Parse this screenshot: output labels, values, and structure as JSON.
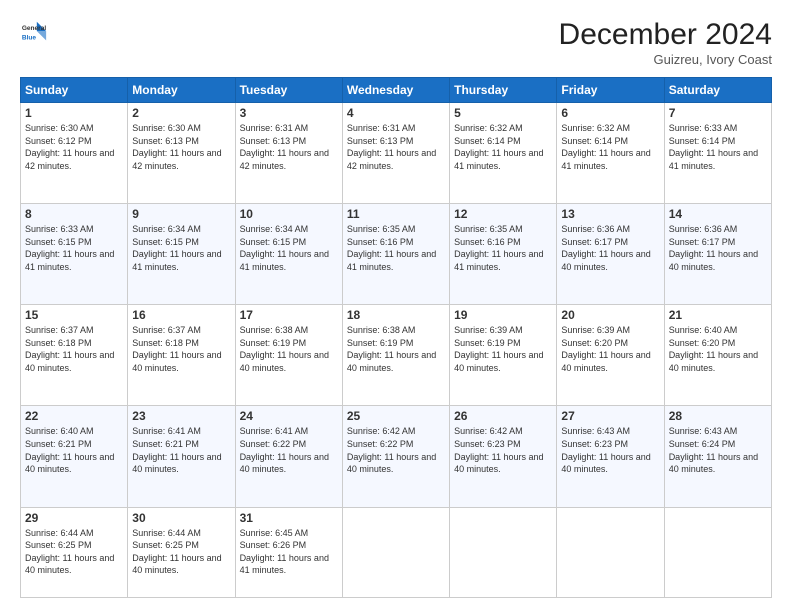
{
  "header": {
    "logo_line1": "General",
    "logo_line2": "Blue",
    "month": "December 2024",
    "location": "Guizreu, Ivory Coast"
  },
  "weekdays": [
    "Sunday",
    "Monday",
    "Tuesday",
    "Wednesday",
    "Thursday",
    "Friday",
    "Saturday"
  ],
  "weeks": [
    [
      {
        "day": "1",
        "sunrise": "6:30 AM",
        "sunset": "6:12 PM",
        "daylight": "11 hours and 42 minutes."
      },
      {
        "day": "2",
        "sunrise": "6:30 AM",
        "sunset": "6:13 PM",
        "daylight": "11 hours and 42 minutes."
      },
      {
        "day": "3",
        "sunrise": "6:31 AM",
        "sunset": "6:13 PM",
        "daylight": "11 hours and 42 minutes."
      },
      {
        "day": "4",
        "sunrise": "6:31 AM",
        "sunset": "6:13 PM",
        "daylight": "11 hours and 42 minutes."
      },
      {
        "day": "5",
        "sunrise": "6:32 AM",
        "sunset": "6:14 PM",
        "daylight": "11 hours and 41 minutes."
      },
      {
        "day": "6",
        "sunrise": "6:32 AM",
        "sunset": "6:14 PM",
        "daylight": "11 hours and 41 minutes."
      },
      {
        "day": "7",
        "sunrise": "6:33 AM",
        "sunset": "6:14 PM",
        "daylight": "11 hours and 41 minutes."
      }
    ],
    [
      {
        "day": "8",
        "sunrise": "6:33 AM",
        "sunset": "6:15 PM",
        "daylight": "11 hours and 41 minutes."
      },
      {
        "day": "9",
        "sunrise": "6:34 AM",
        "sunset": "6:15 PM",
        "daylight": "11 hours and 41 minutes."
      },
      {
        "day": "10",
        "sunrise": "6:34 AM",
        "sunset": "6:15 PM",
        "daylight": "11 hours and 41 minutes."
      },
      {
        "day": "11",
        "sunrise": "6:35 AM",
        "sunset": "6:16 PM",
        "daylight": "11 hours and 41 minutes."
      },
      {
        "day": "12",
        "sunrise": "6:35 AM",
        "sunset": "6:16 PM",
        "daylight": "11 hours and 41 minutes."
      },
      {
        "day": "13",
        "sunrise": "6:36 AM",
        "sunset": "6:17 PM",
        "daylight": "11 hours and 40 minutes."
      },
      {
        "day": "14",
        "sunrise": "6:36 AM",
        "sunset": "6:17 PM",
        "daylight": "11 hours and 40 minutes."
      }
    ],
    [
      {
        "day": "15",
        "sunrise": "6:37 AM",
        "sunset": "6:18 PM",
        "daylight": "11 hours and 40 minutes."
      },
      {
        "day": "16",
        "sunrise": "6:37 AM",
        "sunset": "6:18 PM",
        "daylight": "11 hours and 40 minutes."
      },
      {
        "day": "17",
        "sunrise": "6:38 AM",
        "sunset": "6:19 PM",
        "daylight": "11 hours and 40 minutes."
      },
      {
        "day": "18",
        "sunrise": "6:38 AM",
        "sunset": "6:19 PM",
        "daylight": "11 hours and 40 minutes."
      },
      {
        "day": "19",
        "sunrise": "6:39 AM",
        "sunset": "6:19 PM",
        "daylight": "11 hours and 40 minutes."
      },
      {
        "day": "20",
        "sunrise": "6:39 AM",
        "sunset": "6:20 PM",
        "daylight": "11 hours and 40 minutes."
      },
      {
        "day": "21",
        "sunrise": "6:40 AM",
        "sunset": "6:20 PM",
        "daylight": "11 hours and 40 minutes."
      }
    ],
    [
      {
        "day": "22",
        "sunrise": "6:40 AM",
        "sunset": "6:21 PM",
        "daylight": "11 hours and 40 minutes."
      },
      {
        "day": "23",
        "sunrise": "6:41 AM",
        "sunset": "6:21 PM",
        "daylight": "11 hours and 40 minutes."
      },
      {
        "day": "24",
        "sunrise": "6:41 AM",
        "sunset": "6:22 PM",
        "daylight": "11 hours and 40 minutes."
      },
      {
        "day": "25",
        "sunrise": "6:42 AM",
        "sunset": "6:22 PM",
        "daylight": "11 hours and 40 minutes."
      },
      {
        "day": "26",
        "sunrise": "6:42 AM",
        "sunset": "6:23 PM",
        "daylight": "11 hours and 40 minutes."
      },
      {
        "day": "27",
        "sunrise": "6:43 AM",
        "sunset": "6:23 PM",
        "daylight": "11 hours and 40 minutes."
      },
      {
        "day": "28",
        "sunrise": "6:43 AM",
        "sunset": "6:24 PM",
        "daylight": "11 hours and 40 minutes."
      }
    ],
    [
      {
        "day": "29",
        "sunrise": "6:44 AM",
        "sunset": "6:25 PM",
        "daylight": "11 hours and 40 minutes."
      },
      {
        "day": "30",
        "sunrise": "6:44 AM",
        "sunset": "6:25 PM",
        "daylight": "11 hours and 40 minutes."
      },
      {
        "day": "31",
        "sunrise": "6:45 AM",
        "sunset": "6:26 PM",
        "daylight": "11 hours and 41 minutes."
      },
      null,
      null,
      null,
      null
    ]
  ]
}
